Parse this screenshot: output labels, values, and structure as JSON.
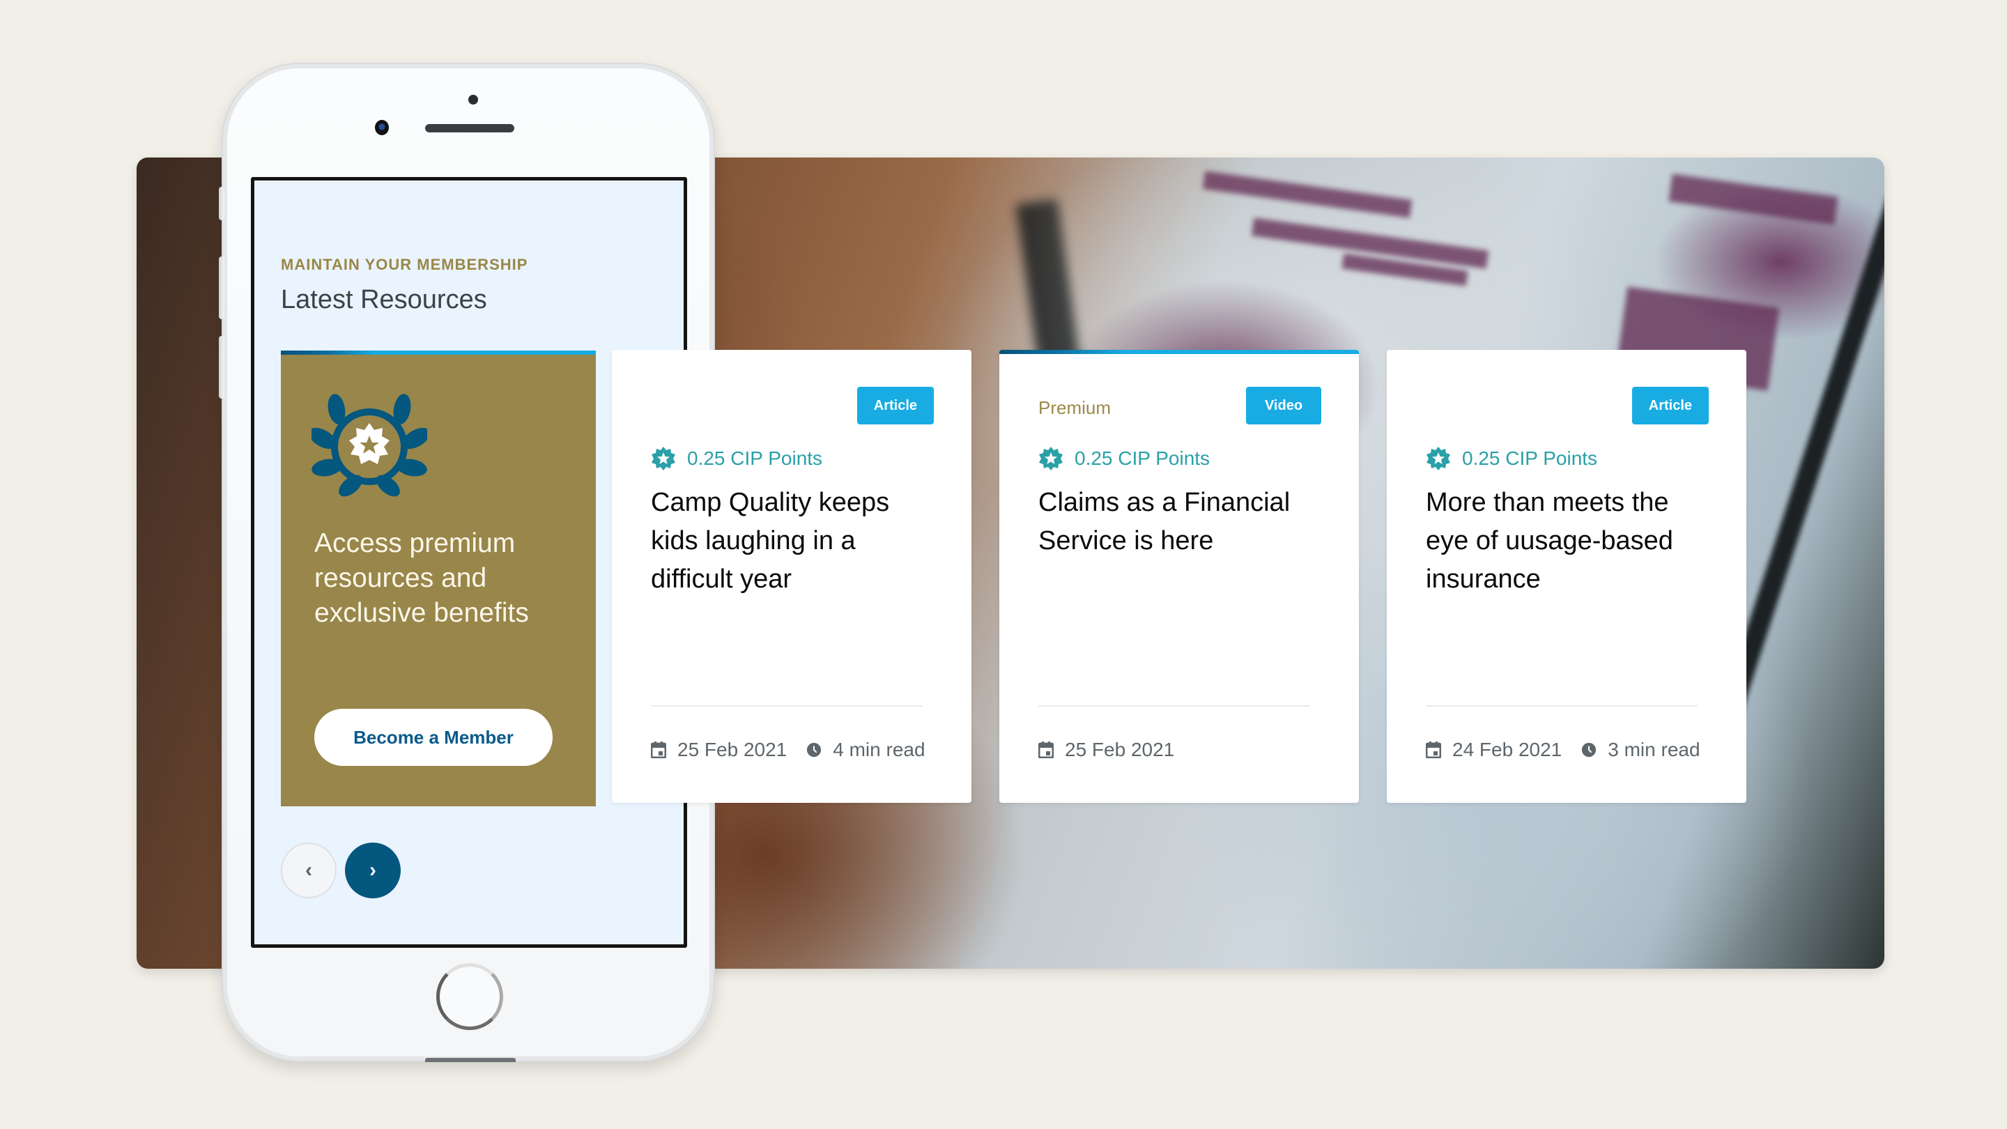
{
  "phone": {
    "eyebrow": "MAINTAIN YOUR MEMBERSHIP",
    "section_title": "Latest Resources",
    "premium_card": {
      "icon": "laurel-badge-icon",
      "text": "Access premium resources and exclusive benefits",
      "button_label": "Become a Member"
    },
    "nav": {
      "prev_icon": "‹",
      "next_icon": "›"
    }
  },
  "resources": [
    {
      "premium_label": "",
      "type": "Article",
      "cip": "0.25 CIP Points",
      "title": "Camp Quality keeps kids laughing in a difficult year",
      "date": "25 Feb 2021",
      "read_time": "4 min read",
      "featured": false
    },
    {
      "premium_label": "Premium",
      "type": "Video",
      "cip": "0.25 CIP Points",
      "title": "Claims as a Financial Service is here",
      "date": "25 Feb 2021",
      "read_time": "",
      "featured": true
    },
    {
      "premium_label": "",
      "type": "Article",
      "cip": "0.25 CIP Points",
      "title": "More than meets the eye of uusage-based insurance",
      "date": "24 Feb 2021",
      "read_time": "3 min read",
      "featured": false
    }
  ],
  "colors": {
    "page_bg": "#f1efe7",
    "gold": "#98864a",
    "brand_blue": "#04577f",
    "accent_blue": "#18ace3",
    "teal": "#2aa0a8",
    "screen_bg": "#eaf4fe"
  }
}
